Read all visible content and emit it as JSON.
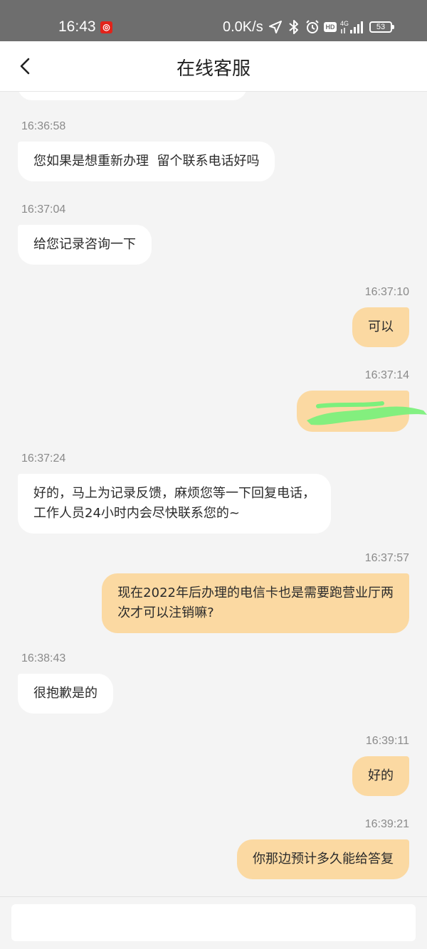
{
  "status_bar": {
    "time": "16:43",
    "netease_icon": "netease-music-icon",
    "network_speed": "0.0K/s",
    "network_type": "4G",
    "hd_label": "HD",
    "battery_level": "53"
  },
  "header": {
    "title": "在线客服",
    "back_icon": "chevron-left-icon"
  },
  "messages": [
    {
      "time": "16:36:58",
      "side": "agent",
      "text": "您如果是想重新办理  留个联系电话好吗"
    },
    {
      "time": "16:37:04",
      "side": "agent",
      "text": "给您记录咨询一下"
    },
    {
      "time": "16:37:10",
      "side": "user",
      "text": "可以"
    },
    {
      "time": "16:37:14",
      "side": "user",
      "text": "",
      "redacted": true
    },
    {
      "time": "16:37:24",
      "side": "agent",
      "text": "好的，马上为记录反馈，麻烦您等一下回复电话，\n工作人员24小时内会尽快联系您的~"
    },
    {
      "time": "16:37:57",
      "side": "user",
      "text": "现在2022年后办理的电信卡也是需要跑营业厅两\n次才可以注销嘛?"
    },
    {
      "time": "16:38:43",
      "side": "agent",
      "text": "很抱歉是的"
    },
    {
      "time": "16:39:11",
      "side": "user",
      "text": "好的"
    },
    {
      "time": "16:39:21",
      "side": "user",
      "text": "你那边预计多久能给答复"
    }
  ],
  "input": {
    "placeholder": ""
  },
  "colors": {
    "status_bar": "#6e6e6e",
    "user_bubble": "#fbd9a2",
    "agent_bubble": "#ffffff",
    "background": "#f4f4f4",
    "redaction": "#7cf07c"
  }
}
